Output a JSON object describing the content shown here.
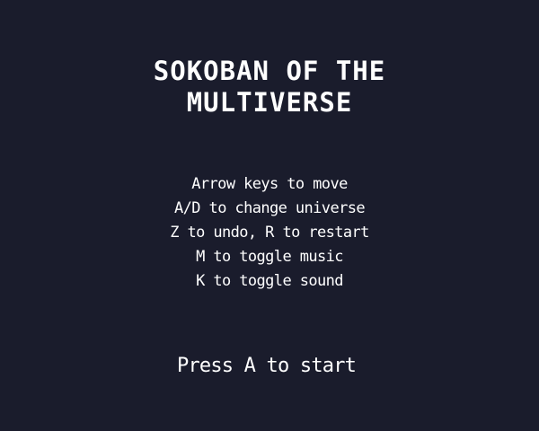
{
  "game": {
    "title_line_1": "SOKOBAN OF THE",
    "title_line_2": "MULTIVERSE"
  },
  "instructions": [
    "Arrow keys to move",
    "A/D to change universe",
    "Z to undo, R to restart",
    "M to toggle music",
    "K to toggle sound"
  ],
  "prompt": {
    "start": "Press A to start"
  },
  "colors": {
    "background": "#1a1c2c",
    "text": "#ffffff"
  }
}
